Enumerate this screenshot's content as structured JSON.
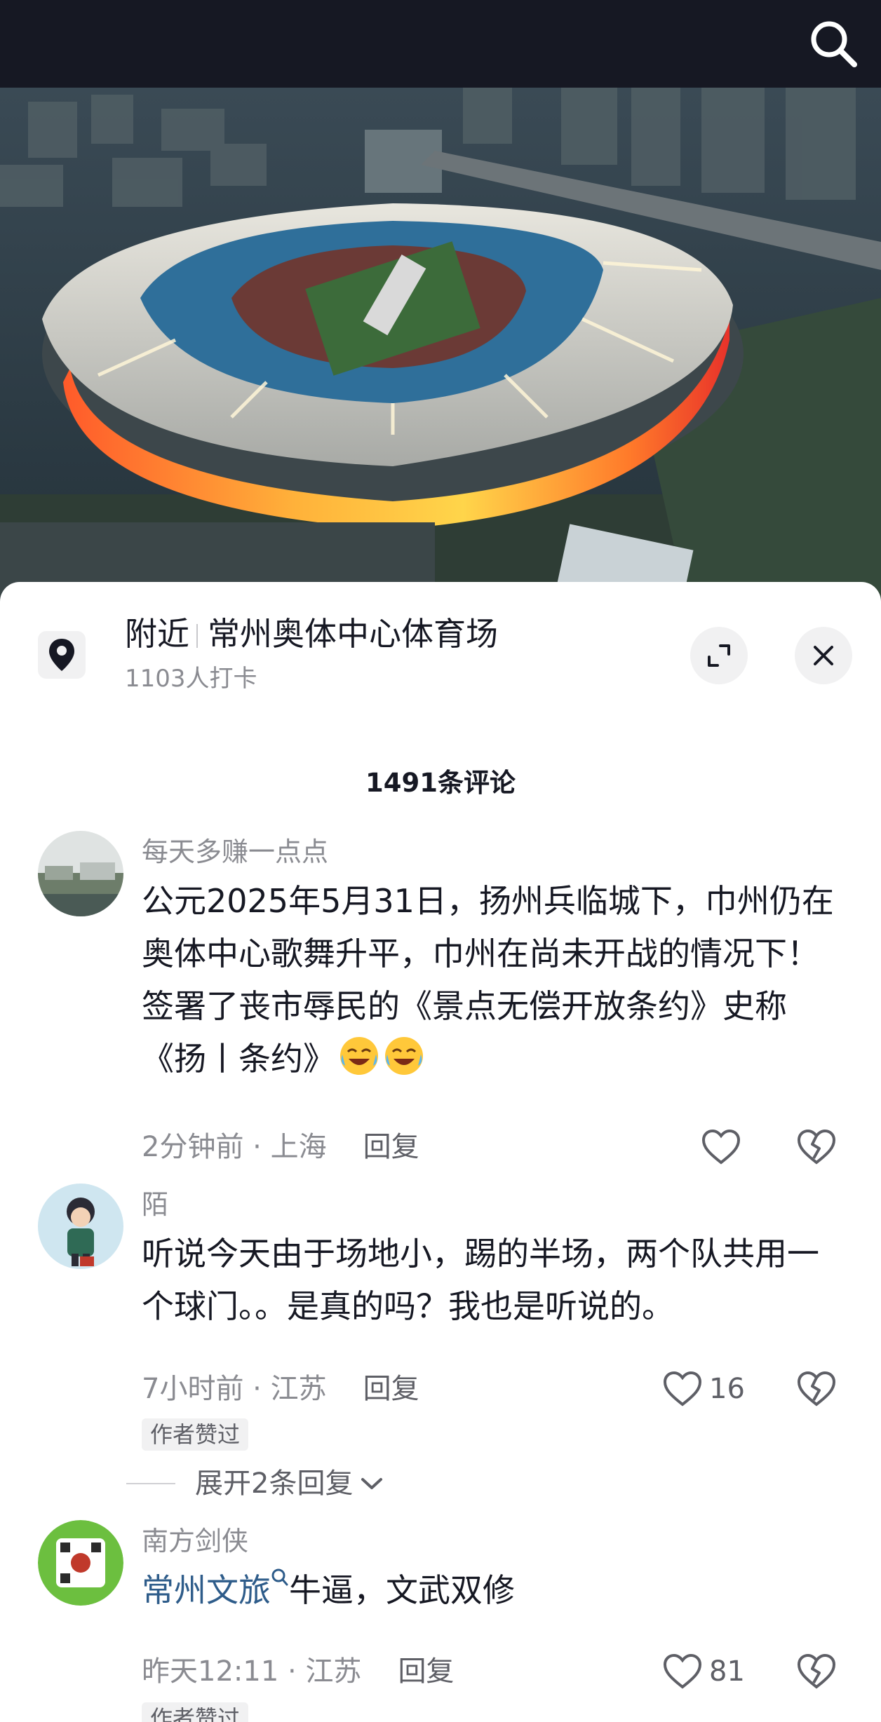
{
  "header": {
    "search_icon": "search-icon",
    "background": "#161823"
  },
  "location": {
    "icon": "location-pin-icon",
    "nearby_label": "附近",
    "place_name": "常州奥体中心体育场",
    "checkins": "1103人打卡",
    "expand_icon": "expand-icon",
    "close_icon": "close-icon"
  },
  "comments_header": {
    "count_label": "1491条评论"
  },
  "comments": [
    {
      "username": "每天多赚一点点",
      "text": "公元2025年5月31日，扬州兵临城下，巾州仍在奥体中心歌舞升平，巾州在尚未开战的情况下！签署了丧市辱民的《景点无偿开放条约》史称《扬丨条约》",
      "emoji": "laugh-cry-emoji",
      "time": "2分钟前",
      "location": "上海",
      "reply_label": "回复",
      "like_count": ""
    },
    {
      "username": "陌",
      "text": "听说今天由于场地小，踢的半场，两个队共用一个球门。。是真的吗？我也是听说的。",
      "time": "7小时前",
      "location": "江苏",
      "reply_label": "回复",
      "like_count": "16",
      "badge": "作者赞过",
      "expand_label": "展开2条回复"
    },
    {
      "username": "南方剑侠",
      "mention": "常州文旅",
      "text_after": "牛逼，文武双修",
      "time": "昨天12:11",
      "location": "江苏",
      "reply_label": "回复",
      "like_count": "81",
      "badge": "作者赞过"
    }
  ],
  "colors": {
    "primary_text": "#161823",
    "secondary_text": "#8a8b91",
    "mention_link": "#2e5c8a",
    "chip_bg": "#f1f1f2"
  }
}
